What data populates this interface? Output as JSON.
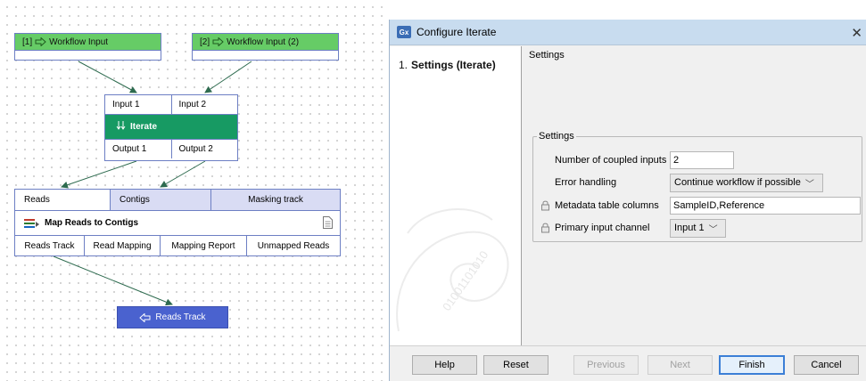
{
  "workflow": {
    "input1": {
      "index": "[1]",
      "label": "Workflow Input"
    },
    "input2": {
      "index": "[2]",
      "label": "Workflow Input (2)"
    },
    "iterate": {
      "inputs": [
        "Input 1",
        "Input 2"
      ],
      "name": "Iterate",
      "outputs": [
        "Output 1",
        "Output 2"
      ]
    },
    "map_reads": {
      "inputs": [
        "Reads",
        "Contigs",
        "Masking track"
      ],
      "name": "Map Reads to Contigs",
      "outputs": [
        "Reads Track",
        "Read Mapping",
        "Mapping Report",
        "Unmapped Reads"
      ]
    },
    "output": {
      "label": "Reads Track"
    },
    "colors": {
      "input": "#66cc66",
      "iterate": "#179a63",
      "output": "#4a62cf",
      "port_border": "#6d7fc4"
    }
  },
  "dialog": {
    "app_icon": "Gx",
    "title": "Configure Iterate",
    "steps": [
      {
        "number": "1.",
        "label": "Settings (Iterate)"
      }
    ],
    "content_heading": "Settings",
    "group_title": "Settings",
    "fields": {
      "coupled_inputs": {
        "label": "Number of coupled inputs",
        "value": "2"
      },
      "error_handling": {
        "label": "Error handling",
        "value": "Continue workflow if possible"
      },
      "metadata_columns": {
        "label": "Metadata table columns",
        "value": "SampleID,Reference"
      },
      "primary_channel": {
        "label": "Primary input channel",
        "value": "Input 1"
      }
    },
    "buttons": {
      "help": "Help",
      "reset": "Reset",
      "previous": "Previous",
      "next": "Next",
      "finish": "Finish",
      "cancel": "Cancel"
    },
    "watermark_text": "01001101010"
  }
}
